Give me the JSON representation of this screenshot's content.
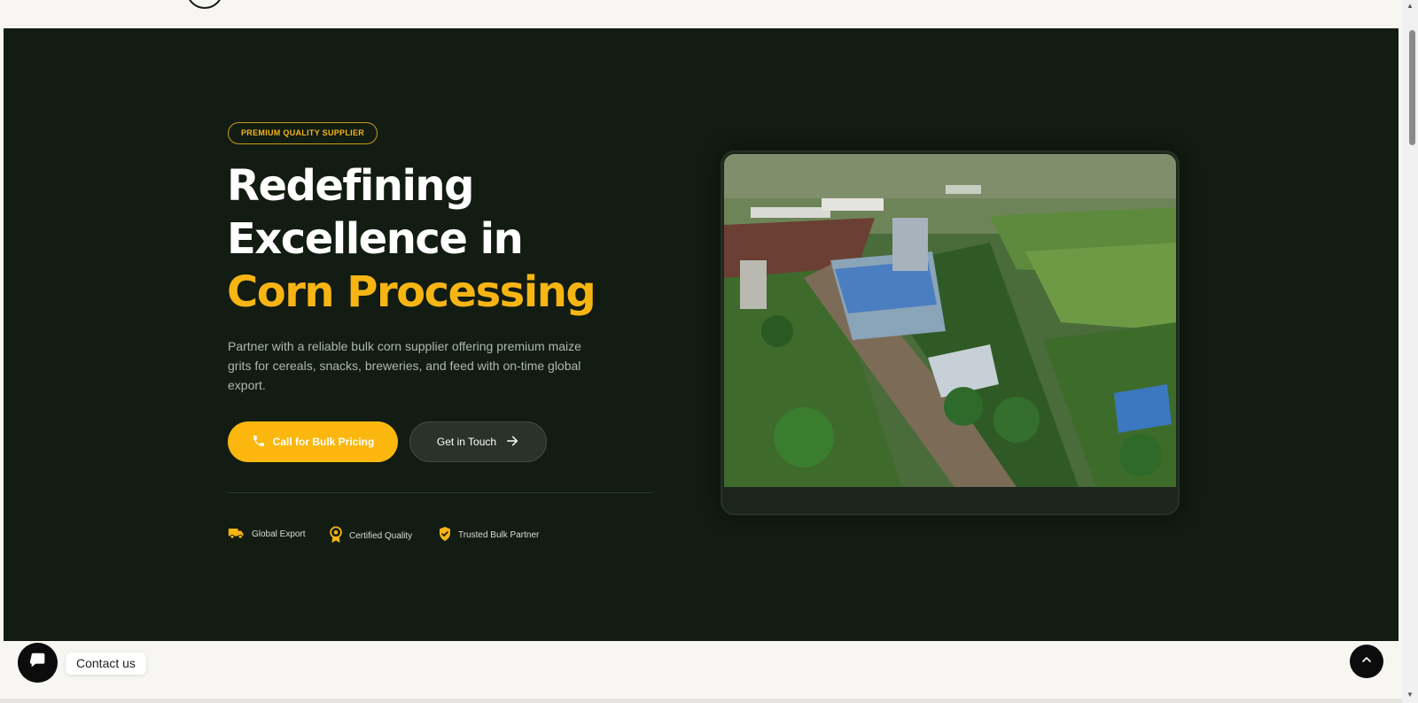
{
  "hero": {
    "badge": "PREMIUM QUALITY SUPPLIER",
    "headline_line1": "Redefining",
    "headline_line2": "Excellence in",
    "headline_accent": "Corn Processing",
    "description": "Partner with a reliable bulk corn supplier offering premium maize grits for cereals, snacks, breweries, and feed with on-time global export.",
    "primary_cta": "Call for Bulk Pricing",
    "secondary_cta": "Get in Touch",
    "trust_items": [
      {
        "label": "Global Export",
        "icon": "truck-icon"
      },
      {
        "label": "Certified Quality",
        "icon": "award-icon"
      },
      {
        "label": "Trusted Bulk Partner",
        "icon": "shield-check-icon"
      }
    ]
  },
  "widgets": {
    "contact_label": "Contact us"
  },
  "colors": {
    "hero_bg": "#121c12",
    "accent": "#fbb70e",
    "text_muted": "#aeb8ac"
  }
}
